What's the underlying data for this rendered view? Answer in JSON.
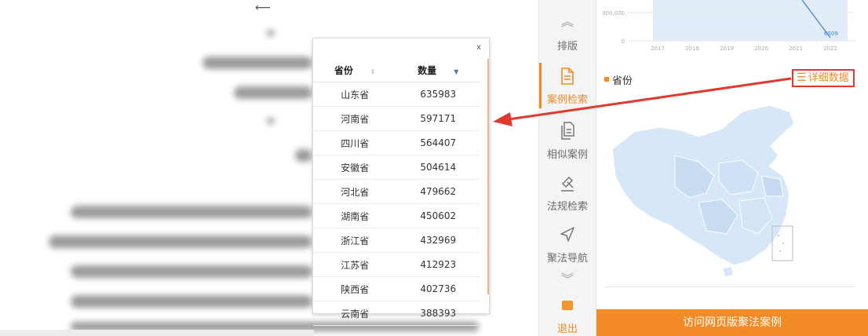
{
  "popup": {
    "close_label": "x",
    "headers": {
      "province": "省份",
      "count": "数量"
    },
    "rows": [
      {
        "province": "山东省",
        "count": "635983"
      },
      {
        "province": "河南省",
        "count": "597171"
      },
      {
        "province": "四川省",
        "count": "564407"
      },
      {
        "province": "安徽省",
        "count": "504614"
      },
      {
        "province": "河北省",
        "count": "479662"
      },
      {
        "province": "湖南省",
        "count": "450602"
      },
      {
        "province": "浙江省",
        "count": "432969"
      },
      {
        "province": "江苏省",
        "count": "412923"
      },
      {
        "province": "陕西省",
        "count": "402736"
      },
      {
        "province": "云南省",
        "count": "388393"
      }
    ]
  },
  "sidenav": {
    "items": [
      {
        "label": "排版",
        "icon": "double-chevron-up-icon"
      },
      {
        "label": "案例检索",
        "icon": "document-icon",
        "active": true
      },
      {
        "label": "相似案例",
        "icon": "copy-document-icon"
      },
      {
        "label": "法规检索",
        "icon": "gavel-icon"
      },
      {
        "label": "聚法导航",
        "icon": "navigation-arrow-icon"
      }
    ],
    "exit_label": "退出"
  },
  "chart_data": {
    "type": "area",
    "x": [
      "2017",
      "2018",
      "2019",
      "2020",
      "2021",
      "2022"
    ],
    "y_ticks": [
      "300,000",
      "0"
    ],
    "last_value_label": "6509",
    "ylim": [
      0,
      300000
    ]
  },
  "right": {
    "legend_label": "省份",
    "detail_button": "详细数据",
    "visit_button": "访问网页版聚法案例"
  },
  "colors": {
    "accent": "#f28a24",
    "annotation": "#e03a2f",
    "map_fill": "#d6e7f7",
    "chart_line": "#3a7fd5"
  }
}
